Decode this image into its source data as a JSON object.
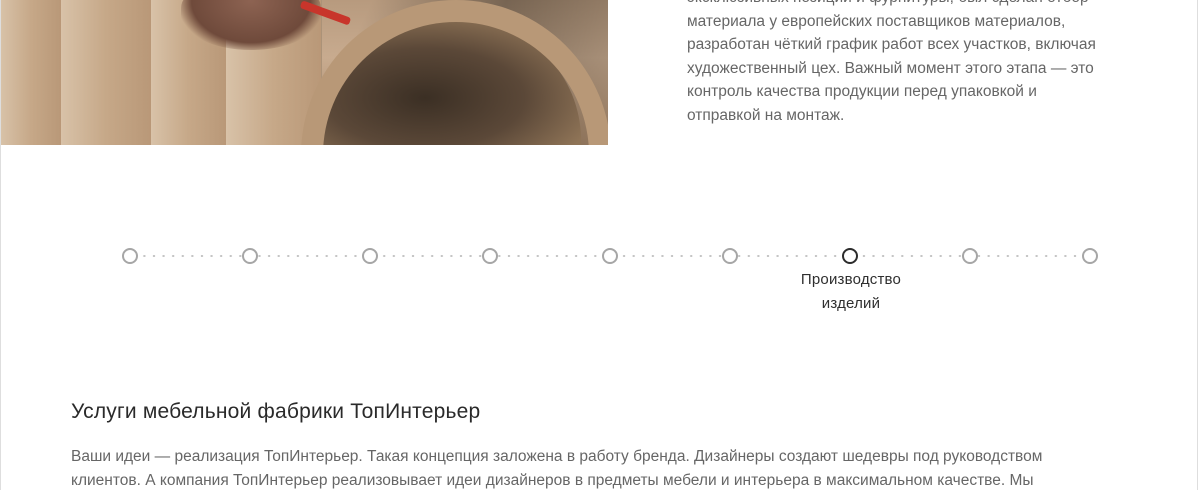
{
  "story": {
    "lines": [
      "эксклюзивных позиций и фурнитуры, был сделан отбор",
      "материала у европейских поставщиков материалов,",
      "разработан чёткий график работ всех участков, включая",
      "художественный цех. Важный момент этого этапа — это",
      "контроль качества продукции перед упаковкой и",
      "отправкой на монтаж."
    ]
  },
  "timeline": {
    "steps": 9,
    "active_index": 6,
    "active_label_line1": "Производство",
    "active_label_line2": "изделий",
    "colors": {
      "inactive": "#a6a6a6",
      "active": "#2c2c2c",
      "dots": "#c5c5c5"
    }
  },
  "services": {
    "title": "Услуги мебельной фабрики ТопИнтерьер",
    "line1": "Ваши идеи — реализация ТопИнтерьер. Такая концепция заложена в работу бренда. Дизайнеры создают шедевры под руководством",
    "line2": "клиентов. А компания ТопИнтерьер реализовывает идеи дизайнеров в предметы мебели и интерьера в максимальном качестве. Мы"
  }
}
